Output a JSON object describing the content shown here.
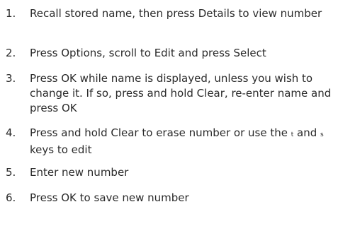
{
  "steps": [
    {
      "number": "1.",
      "parts": [
        "Recall stored name, then press ",
        "Details",
        " to view number"
      ]
    },
    {
      "number": "2.",
      "parts": [
        "Press ",
        "Options",
        ", scroll to ",
        "Edit",
        " and press ",
        "Select"
      ]
    },
    {
      "number": "3.",
      "parts": [
        "Press ",
        "OK",
        " while name is displayed, unless you wish to change it. If so, press and hold ",
        "Clear",
        ", re-enter name and press ",
        "OK"
      ]
    },
    {
      "number": "4.",
      "parts": [
        "Press and hold ",
        "Clear",
        " to erase number or use the ",
        "t",
        " and ",
        "s",
        " keys to edit"
      ]
    },
    {
      "number": "5.",
      "parts": [
        "Enter new number"
      ]
    },
    {
      "number": "6.",
      "parts": [
        "Press ",
        "OK",
        " to save new number"
      ]
    }
  ]
}
